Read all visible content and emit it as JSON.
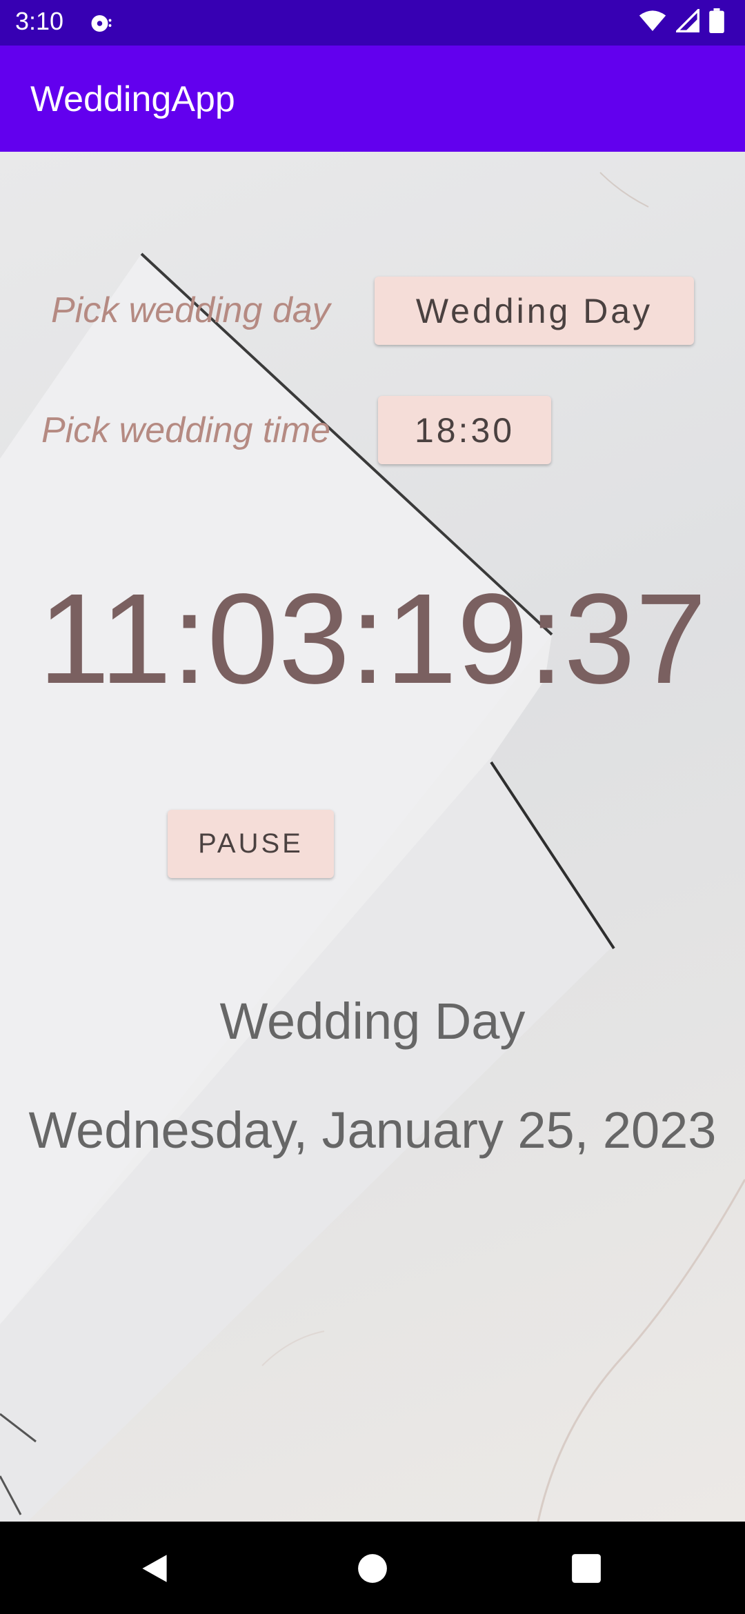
{
  "status_bar": {
    "time": "3:10"
  },
  "app_bar": {
    "title": "WeddingApp"
  },
  "form": {
    "day_label": "Pick wedding day",
    "day_button": "Wedding Day",
    "time_label": "Pick wedding time",
    "time_button": "18:30"
  },
  "countdown": {
    "value": "11:03:19:37"
  },
  "controls": {
    "pause_button": "PAUSE"
  },
  "wedding": {
    "title": "Wedding Day",
    "date": "Wednesday, January 25, 2023"
  },
  "colors": {
    "status_bar": "#3700b3",
    "app_bar": "#6200ee",
    "button_bg": "#f5ddd8",
    "label_text": "#b58a82",
    "countdown_text": "#7a6060"
  },
  "icons": {
    "status_app": "notification-app-icon",
    "wifi": "wifi-icon",
    "signal": "cell-signal-icon",
    "battery": "battery-icon",
    "back": "back-icon",
    "home": "home-icon",
    "recents": "recents-icon"
  }
}
